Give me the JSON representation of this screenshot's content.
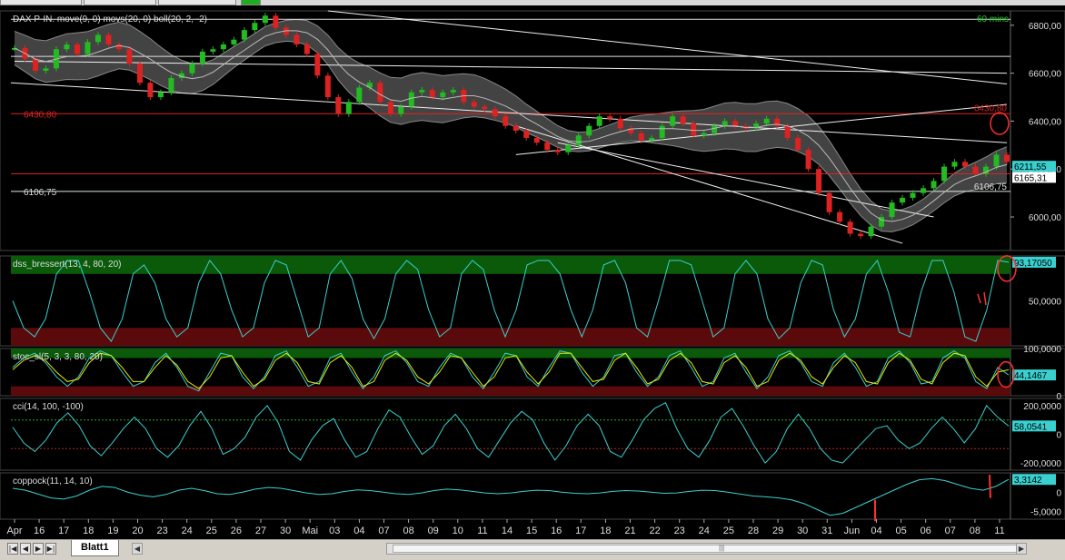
{
  "app": {
    "sheet_tab": "Blatt1"
  },
  "navigation": {
    "first": "|◀",
    "prev": "◀",
    "next": "▶",
    "last": "▶|",
    "scroll_grip": "|||",
    "scroll_left": "◀",
    "scroll_right": "▶"
  },
  "colors": {
    "background": "#000000",
    "cyan_line": "#3ad0d0",
    "up_candle": "#22bb22",
    "down_candle": "#dd2222",
    "band_fill": "#5a5a5a",
    "red_level": "#dd2222",
    "green_zone": "#0a5a0a",
    "red_zone": "#5a0a0a",
    "price_tag": "#e8e800",
    "axis_label": "#dddddd"
  },
  "chart_data": [
    {
      "type": "line",
      "panel": "price",
      "title": "DAX P-IN. move(9, 0) movs(20, 0) boll(20, 2, -2)",
      "timeframe": "60 mins",
      "description": "Hourly DAX candlesticks with Bollinger band (20,2,-2) and moving averages; trendlines drawn",
      "y_ticks": [
        "6800,00",
        "6600,00",
        "6400,00",
        "6200,00",
        "6000,00"
      ],
      "y_tick_values": [
        6800,
        6600,
        6400,
        6200,
        6000
      ],
      "ylim": [
        5860,
        6860
      ],
      "horizontal_levels": [
        {
          "label": "6430,80",
          "value": 6430.8,
          "color": "#dd2222"
        },
        {
          "label": "6106,75",
          "value": 6106.75,
          "color": "#ddeedd"
        }
      ],
      "current_values": [
        {
          "label": "6211,55",
          "value": 6211.55
        },
        {
          "label": "6165,31",
          "value": 6165.31
        }
      ],
      "right_annotations": [
        {
          "label": "6430,80",
          "value": 6430.8
        },
        {
          "label": "6106,75",
          "value": 6106.75
        }
      ],
      "close_series": [
        6705,
        6660,
        6610,
        6620,
        6700,
        6720,
        6680,
        6730,
        6760,
        6720,
        6700,
        6640,
        6560,
        6500,
        6520,
        6580,
        6600,
        6640,
        6690,
        6700,
        6720,
        6740,
        6780,
        6810,
        6840,
        6790,
        6760,
        6720,
        6680,
        6590,
        6500,
        6430,
        6480,
        6540,
        6560,
        6480,
        6430,
        6460,
        6520,
        6530,
        6500,
        6520,
        6530,
        6480,
        6460,
        6450,
        6420,
        6380,
        6360,
        6330,
        6310,
        6280,
        6270,
        6300,
        6340,
        6380,
        6420,
        6410,
        6370,
        6350,
        6320,
        6330,
        6380,
        6420,
        6390,
        6340,
        6350,
        6380,
        6400,
        6380,
        6370,
        6390,
        6410,
        6380,
        6330,
        6280,
        6200,
        6100,
        6020,
        5980,
        5930,
        5920,
        5960,
        6000,
        6060,
        6080,
        6100,
        6120,
        6150,
        6210,
        6230,
        6210,
        6180,
        6210,
        6260,
        6230
      ]
    },
    {
      "type": "line",
      "panel": "dss_bressert",
      "title": "dss_bressert(13, 4, 80, 20)",
      "y_ticks": [
        "50,0000"
      ],
      "zones": {
        "upper": 80,
        "lower": 20
      },
      "ylim": [
        0,
        100
      ],
      "current_value": "93,17050",
      "series": [
        {
          "values": [
            50,
            20,
            10,
            30,
            80,
            95,
            95,
            60,
            20,
            5,
            30,
            80,
            90,
            70,
            30,
            10,
            20,
            70,
            95,
            80,
            40,
            10,
            20,
            70,
            95,
            90,
            50,
            10,
            20,
            80,
            95,
            75,
            30,
            8,
            30,
            80,
            95,
            85,
            40,
            10,
            20,
            80,
            95,
            85,
            40,
            10,
            40,
            90,
            95,
            95,
            80,
            40,
            10,
            40,
            90,
            95,
            70,
            20,
            10,
            50,
            95,
            95,
            90,
            50,
            10,
            20,
            80,
            95,
            80,
            30,
            8,
            20,
            70,
            95,
            90,
            40,
            10,
            30,
            80,
            95,
            60,
            15,
            10,
            60,
            95,
            95,
            60,
            10,
            5,
            40,
            95,
            93
          ]
        }
      ]
    },
    {
      "type": "line",
      "panel": "stoc_sl",
      "title": "stoc_sl(5, 3, 3, 80, 20)",
      "y_ticks": [
        "100,0000",
        "0"
      ],
      "zones": {
        "upper": 80,
        "lower": 20
      },
      "ylim": [
        0,
        100
      ],
      "current_value": "44,1467",
      "series": [
        {
          "values": [
            60,
            80,
            90,
            70,
            40,
            20,
            40,
            80,
            95,
            85,
            50,
            20,
            30,
            70,
            90,
            60,
            20,
            10,
            50,
            90,
            85,
            40,
            15,
            40,
            85,
            95,
            60,
            20,
            30,
            80,
            90,
            50,
            15,
            40,
            85,
            95,
            70,
            30,
            20,
            60,
            90,
            80,
            40,
            15,
            50,
            90,
            85,
            40,
            20,
            60,
            95,
            90,
            50,
            20,
            40,
            85,
            90,
            50,
            20,
            40,
            85,
            95,
            60,
            20,
            30,
            80,
            90,
            50,
            15,
            40,
            85,
            95,
            70,
            30,
            20,
            70,
            90,
            60,
            20,
            30,
            80,
            95,
            70,
            25,
            30,
            80,
            95,
            80,
            30,
            15,
            60,
            44
          ]
        },
        {
          "values": [
            55,
            75,
            85,
            75,
            50,
            30,
            35,
            70,
            90,
            85,
            60,
            30,
            30,
            60,
            85,
            65,
            30,
            15,
            40,
            80,
            85,
            50,
            20,
            35,
            75,
            90,
            70,
            30,
            25,
            70,
            85,
            60,
            20,
            30,
            75,
            90,
            75,
            40,
            25,
            50,
            85,
            80,
            50,
            20,
            40,
            80,
            85,
            50,
            25,
            50,
            90,
            90,
            60,
            30,
            35,
            75,
            90,
            60,
            25,
            35,
            75,
            90,
            70,
            30,
            25,
            70,
            85,
            60,
            20,
            30,
            75,
            90,
            75,
            40,
            25,
            60,
            85,
            70,
            30,
            25,
            70,
            90,
            75,
            35,
            25,
            70,
            90,
            85,
            40,
            20,
            50,
            55
          ]
        }
      ]
    },
    {
      "type": "line",
      "panel": "cci",
      "title": "cci(14, 100, -100)",
      "y_ticks": [
        "200,0000",
        "0",
        "-200,0000"
      ],
      "levels": [
        100,
        -100
      ],
      "ylim": [
        -250,
        250
      ],
      "current_value": "58,0541",
      "series": [
        {
          "values": [
            50,
            -60,
            -120,
            -40,
            80,
            150,
            60,
            -80,
            -150,
            -60,
            40,
            120,
            40,
            -100,
            -160,
            -80,
            60,
            160,
            40,
            -140,
            -100,
            -20,
            120,
            200,
            80,
            -120,
            -180,
            -40,
            60,
            110,
            -40,
            -160,
            -120,
            40,
            170,
            120,
            -20,
            -140,
            -80,
            60,
            140,
            40,
            -100,
            -160,
            -40,
            80,
            160,
            100,
            -60,
            -180,
            -80,
            60,
            140,
            60,
            -120,
            -160,
            -40,
            100,
            180,
            220,
            40,
            -100,
            -160,
            -40,
            120,
            180,
            60,
            -80,
            -200,
            -120,
            40,
            140,
            40,
            -100,
            -180,
            -200,
            -120,
            -40,
            40,
            60,
            -40,
            -100,
            -60,
            40,
            120,
            40,
            -60,
            40,
            200,
            120,
            58
          ]
        }
      ]
    },
    {
      "type": "line",
      "panel": "coppock",
      "title": "coppock(11, 14, 10)",
      "y_ticks": [
        "0",
        "-5,0000"
      ],
      "ylim": [
        -7,
        5
      ],
      "current_value": "3,3142",
      "series": [
        {
          "values": [
            1,
            0.5,
            -0.5,
            -1.5,
            -1.8,
            -1,
            0.5,
            1.5,
            1.2,
            0,
            -0.8,
            -1.2,
            -0.6,
            0.5,
            1,
            0.4,
            -0.4,
            -0.6,
            0,
            0.8,
            1.2,
            1,
            0.4,
            -0.2,
            -0.6,
            -0.4,
            0.2,
            0.6,
            0.4,
            0,
            -0.4,
            -0.6,
            -0.2,
            0.4,
            0.8,
            0.6,
            0.2,
            -0.2,
            -0.4,
            -0.2,
            0.2,
            0.5,
            0.4,
            0,
            -0.3,
            -0.4,
            -0.2,
            0.2,
            0.4,
            0.3,
            0,
            -0.3,
            -0.2,
            0.2,
            0.5,
            0.4,
            0,
            -0.5,
            -1,
            -1.2,
            -1.5,
            -2,
            -3,
            -4.5,
            -6,
            -5.5,
            -4,
            -2.5,
            -1,
            0.5,
            2,
            3.2,
            3.5,
            3,
            2,
            1,
            0.5,
            1.5,
            3.3
          ]
        }
      ]
    }
  ],
  "x_axis": {
    "labels": [
      "Apr",
      "16",
      "17",
      "18",
      "19",
      "20",
      "23",
      "24",
      "25",
      "26",
      "27",
      "30",
      "Mai",
      "03",
      "04",
      "07",
      "08",
      "09",
      "10",
      "11",
      "14",
      "15",
      "16",
      "17",
      "18",
      "21",
      "22",
      "23",
      "24",
      "25",
      "28",
      "29",
      "30",
      "31",
      "Jun",
      "04",
      "05",
      "06",
      "07",
      "08",
      "11"
    ]
  }
}
